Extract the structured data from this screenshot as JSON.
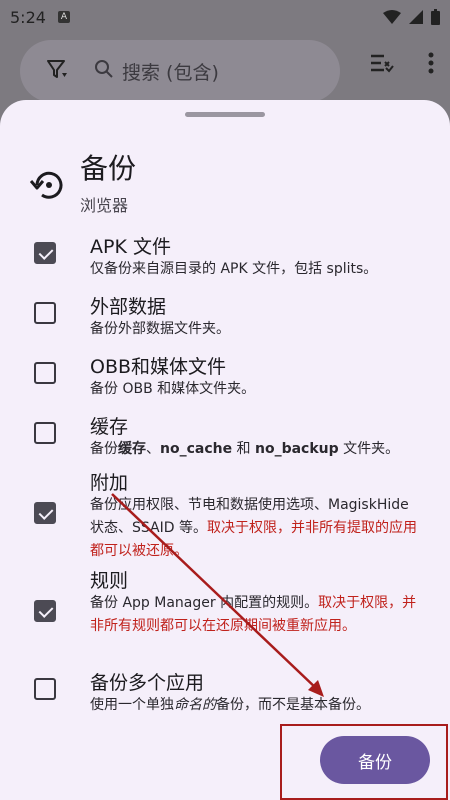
{
  "status_bar": {
    "time": "5:24",
    "badge": "A"
  },
  "search": {
    "placeholder": "搜索 (包含)"
  },
  "sheet": {
    "title": "备份",
    "subtitle": "浏览器",
    "options": [
      {
        "title": "APK 文件",
        "checked": true,
        "desc_plain": "仅备份来自源目录的 APK 文件，包括 splits。"
      },
      {
        "title": "外部数据",
        "checked": false,
        "desc_plain": "备份外部数据文件夹。"
      },
      {
        "title": "OBB和媒体文件",
        "checked": false,
        "desc_plain": "备份 OBB 和媒体文件夹。"
      },
      {
        "title": "缓存",
        "checked": false,
        "desc_pre": "备份",
        "desc_b1": "缓存",
        "desc_mid1": "、",
        "desc_b2": "no_cache",
        "desc_mid2": " 和 ",
        "desc_b3": "no_backup",
        "desc_post": " 文件夹。"
      },
      {
        "title": "附加",
        "checked": true,
        "desc_plain": "备份应用权限、节电和数据使用选项、MagiskHide 状态、SSAID 等。",
        "desc_warn": "取决于权限，并非所有提取的应用都可以被还原。"
      },
      {
        "title": "规则",
        "checked": true,
        "desc_plain": "备份 App Manager 内配置的规则。",
        "desc_warn": "取决于权限，并非所有规则都可以在还原期间被重新应用。"
      },
      {
        "title": "备份多个应用",
        "checked": false,
        "desc_pre": "使用一个单独",
        "desc_i": "命名的",
        "desc_post": "备份，而不是基本备份。"
      }
    ],
    "backup_button": "备份"
  },
  "colors": {
    "accent": "#6a57a0",
    "warning": "#c0221c",
    "annotation": "#a81c1c"
  }
}
